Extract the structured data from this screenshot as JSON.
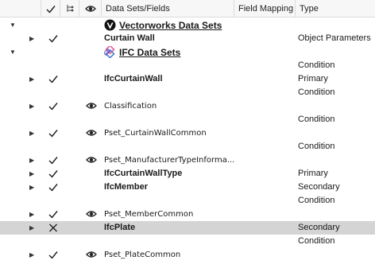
{
  "header": {
    "data_sets_label": "Data Sets/Fields",
    "field_mapping_label": "Field Mapping",
    "type_label": "Type"
  },
  "rows": {
    "vw_set": {
      "name": "Vectorworks Data Sets"
    },
    "curtain_wall": {
      "name": "Curtain Wall",
      "type": "Object Parameters"
    },
    "ifc_set": {
      "name": "IFC Data Sets"
    },
    "cond1": {
      "type": "Condition"
    },
    "ifc_curtain_wall": {
      "name": "IfcCurtainWall",
      "type": "Primary"
    },
    "cond2": {
      "type": "Condition"
    },
    "classification": {
      "name": "Classification"
    },
    "cond3": {
      "type": "Condition"
    },
    "pset_cwc": {
      "name": "Pset_CurtainWallCommon"
    },
    "cond4": {
      "type": "Condition"
    },
    "pset_mti": {
      "name": "Pset_ManufacturerTypeInforma..."
    },
    "ifc_cw_type": {
      "name": "IfcCurtainWallType",
      "type": "Primary"
    },
    "ifc_member": {
      "name": "IfcMember",
      "type": "Secondary"
    },
    "cond5": {
      "type": "Condition"
    },
    "pset_mc": {
      "name": "Pset_MemberCommon"
    },
    "ifc_plate": {
      "name": "IfcPlate",
      "type": "Secondary"
    },
    "cond6": {
      "type": "Condition"
    },
    "pset_pc": {
      "name": "Pset_PlateCommon"
    }
  },
  "icons": {
    "check": "checkmark-icon",
    "excluded": "x-mark-icon",
    "eye": "eye-icon",
    "expand": "expand-arrow-icon",
    "collapse": "collapse-arrow-icon",
    "vectorworks_logo": "vectorworks-logo-icon",
    "ifc_logo": "ifc-logo-icon"
  },
  "colors": {
    "selected_row": "#d4d4d4",
    "header_bg": "#f7f7f7",
    "ifc_pink": "#e05a9a",
    "ifc_blue": "#4a7fd1"
  }
}
